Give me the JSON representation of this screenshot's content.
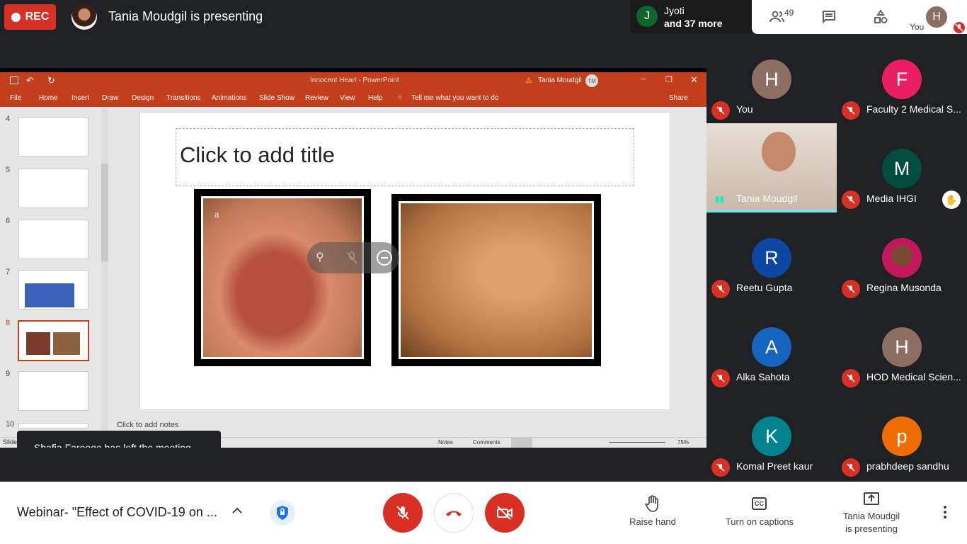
{
  "topbar": {
    "rec_label": "REC",
    "presenter_title": "Tania Moudgil is presenting",
    "others_name": "Jyoti",
    "others_more": "and 37 more",
    "others_initial": "J",
    "people_count": "49",
    "you_label": "You",
    "you_initial": "H"
  },
  "ppt": {
    "doc_title": "Innocent Heart - PowerPoint",
    "user_name": "Tania Moudgil",
    "user_initials": "TM",
    "menu": [
      "File",
      "Home",
      "Insert",
      "Draw",
      "Design",
      "Transitions",
      "Animations",
      "Slide Show",
      "Review",
      "View",
      "Help"
    ],
    "tell_me": "Tell me what you want to do",
    "share": "Share",
    "slide_numbers": [
      "4",
      "5",
      "6",
      "7",
      "8",
      "9",
      "10"
    ],
    "slide_title_placeholder": "Click to add title",
    "image_label": "a",
    "notes_placeholder": "Click to add notes",
    "status": {
      "slide_short": "Slide",
      "notes": "Notes",
      "comments": "Comments",
      "zoom": "75%"
    }
  },
  "toast": "Shafia Farooqe has left the meeting",
  "participants": [
    {
      "name": "You",
      "initial": "H",
      "color": "#8d6e63"
    },
    {
      "name": "Faculty 2 Medical S...",
      "initial": "F",
      "color": "#e91e63"
    },
    {
      "name": "Tania Moudgil",
      "initial": "",
      "color": "#000000"
    },
    {
      "name": "Media IHGI",
      "initial": "M",
      "color": "#004d40"
    },
    {
      "name": "Reetu Gupta",
      "initial": "R",
      "color": "#0d47a1"
    },
    {
      "name": "Regina Musonda",
      "initial": "",
      "color": "#c2185b"
    },
    {
      "name": "Alka Sahota",
      "initial": "A",
      "color": "#1565c0"
    },
    {
      "name": "HOD Medical Scien...",
      "initial": "H",
      "color": "#8d6e63"
    },
    {
      "name": "Komal Preet kaur",
      "initial": "K",
      "color": "#00838f"
    },
    {
      "name": "prabhdeep sandhu",
      "initial": "p",
      "color": "#ef6c00"
    }
  ],
  "bottom": {
    "meeting_title": "Webinar- \"Effect of COVID-19 on ...",
    "raise_hand": "Raise hand",
    "captions": "Turn on captions",
    "presenting_line1": "Tania Moudgil",
    "presenting_line2": "is presenting"
  }
}
